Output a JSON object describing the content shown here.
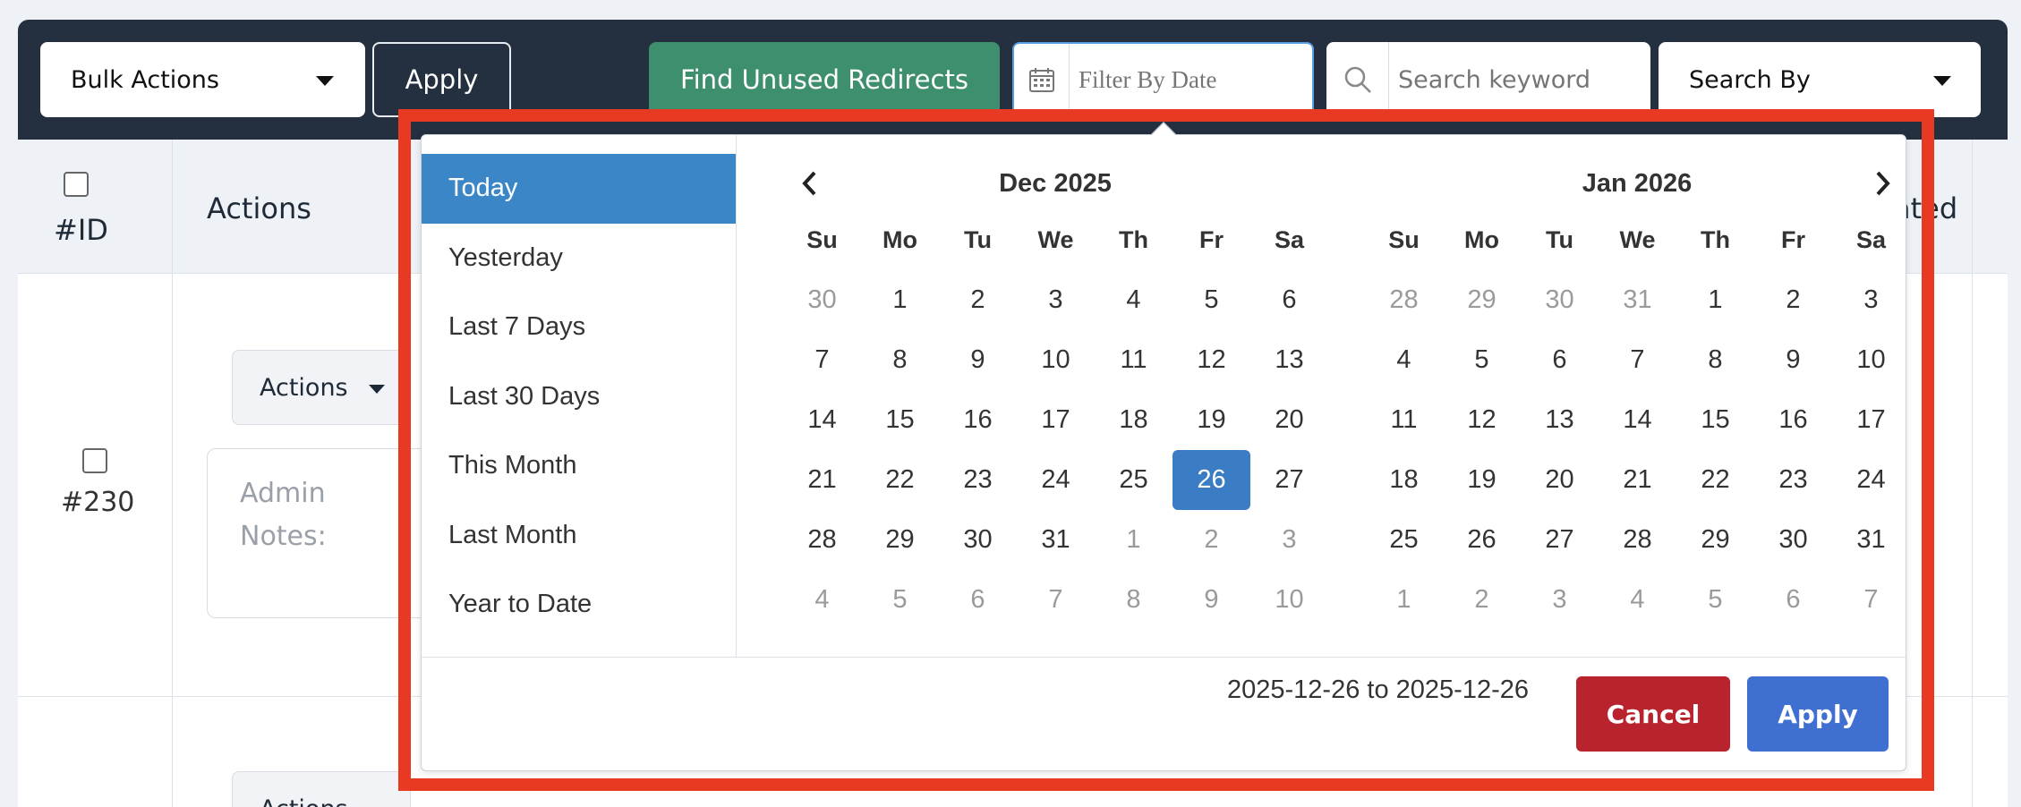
{
  "toolbar": {
    "bulk_actions_label": "Bulk Actions",
    "apply_label": "Apply",
    "find_unused_label": "Find Unused Redirects",
    "date_filter_placeholder": "Filter By Date",
    "search_placeholder": "Search keyword",
    "search_by_label": "Search By"
  },
  "table": {
    "headers": {
      "id": "#ID",
      "actions": "Actions",
      "last_partial": "ated"
    },
    "rows": [
      {
        "id": "#230",
        "actions_label": "Actions",
        "notes_placeholder": "Admin Notes:"
      },
      {
        "actions_label": "Actions"
      }
    ]
  },
  "datepicker": {
    "ranges": [
      "Today",
      "Yesterday",
      "Last 7 Days",
      "Last 30 Days",
      "This Month",
      "Last Month",
      "Year to Date"
    ],
    "active_range": "Today",
    "weekdays": [
      "Su",
      "Mo",
      "Tu",
      "We",
      "Th",
      "Fr",
      "Sa"
    ],
    "left_month": {
      "title": "Dec 2025",
      "days": [
        "30",
        "1",
        "2",
        "3",
        "4",
        "5",
        "6",
        "7",
        "8",
        "9",
        "10",
        "11",
        "12",
        "13",
        "14",
        "15",
        "16",
        "17",
        "18",
        "19",
        "20",
        "21",
        "22",
        "23",
        "24",
        "25",
        "26",
        "27",
        "28",
        "29",
        "30",
        "31",
        "1",
        "2",
        "3",
        "4",
        "5",
        "6",
        "7",
        "8",
        "9",
        "10"
      ],
      "off_indices": [
        0,
        32,
        33,
        34,
        35,
        36,
        37,
        38,
        39,
        40,
        41
      ],
      "selected_index": 26
    },
    "right_month": {
      "title": "Jan 2026",
      "days": [
        "28",
        "29",
        "30",
        "31",
        "1",
        "2",
        "3",
        "4",
        "5",
        "6",
        "7",
        "8",
        "9",
        "10",
        "11",
        "12",
        "13",
        "14",
        "15",
        "16",
        "17",
        "18",
        "19",
        "20",
        "21",
        "22",
        "23",
        "24",
        "25",
        "26",
        "27",
        "28",
        "29",
        "30",
        "31",
        "1",
        "2",
        "3",
        "4",
        "5",
        "6",
        "7"
      ],
      "off_indices": [
        0,
        1,
        2,
        3,
        35,
        36,
        37,
        38,
        39,
        40,
        41
      ],
      "selected_index": -1
    },
    "selected_range_text": "2025-12-26 to 2025-12-26",
    "cancel_label": "Cancel",
    "apply_label": "Apply"
  },
  "colors": {
    "accent_blue": "#3b86c7",
    "cancel_red": "#b8232e",
    "apply_blue": "#3f6fd1",
    "find_green": "#3d8f6e",
    "highlight_red": "#e83a22"
  }
}
